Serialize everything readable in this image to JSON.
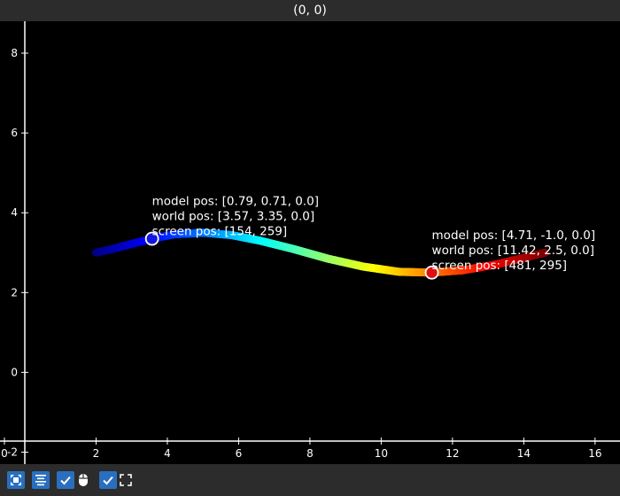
{
  "window": {
    "title": "(0, 0)"
  },
  "axes": {
    "x_ticks": [
      "0",
      "2",
      "4",
      "6",
      "8",
      "10",
      "12",
      "14",
      "16"
    ],
    "y_ticks": [
      "-2",
      "0",
      "2",
      "4",
      "6",
      "8"
    ]
  },
  "chart_data": {
    "type": "line",
    "xlim": [
      0,
      16.7
    ],
    "ylim": [
      -2.3,
      8.8
    ],
    "grid": false,
    "series": [
      {
        "colormap": "jet",
        "points": [
          [
            2.0,
            3.0
          ],
          [
            2.5,
            3.1
          ],
          [
            3.0,
            3.22
          ],
          [
            3.57,
            3.35
          ],
          [
            4.2,
            3.46
          ],
          [
            5.0,
            3.5
          ],
          [
            5.8,
            3.44
          ],
          [
            6.6,
            3.3
          ],
          [
            7.5,
            3.1
          ],
          [
            8.5,
            2.85
          ],
          [
            9.5,
            2.65
          ],
          [
            10.5,
            2.52
          ],
          [
            11.42,
            2.5
          ],
          [
            12.3,
            2.56
          ],
          [
            13.2,
            2.7
          ],
          [
            14.0,
            2.87
          ],
          [
            14.6,
            3.0
          ]
        ]
      }
    ],
    "markers": [
      {
        "x": 3.57,
        "y": 3.35,
        "color": "#1515e0",
        "lines": [
          "model pos: [0.79, 0.71, 0.0]",
          "world pos: [3.57, 3.35, 0.0]",
          "screen pos: [154, 259]"
        ]
      },
      {
        "x": 11.42,
        "y": 2.5,
        "color": "#e01010",
        "lines": [
          "model pos: [4.71, -1.0, 0.0]",
          "world pos: [11.42, 2.5, 0.0]",
          "screen pos: [481, 295]"
        ]
      }
    ]
  },
  "toolbar": {
    "buttons": [
      {
        "icon": "fit-view-icon",
        "name": "fit-view-button"
      },
      {
        "icon": "align-icon",
        "name": "align-button"
      },
      {
        "icon": "checkbox-checked-icon",
        "name": "toggle-mouse-checkbox"
      },
      {
        "icon": "mouse-icon",
        "name": "mouse-mode-button"
      },
      {
        "icon": "checkbox-checked-icon",
        "name": "toggle-fullscreen-checkbox"
      },
      {
        "icon": "fullscreen-icon",
        "name": "fullscreen-button"
      }
    ]
  }
}
